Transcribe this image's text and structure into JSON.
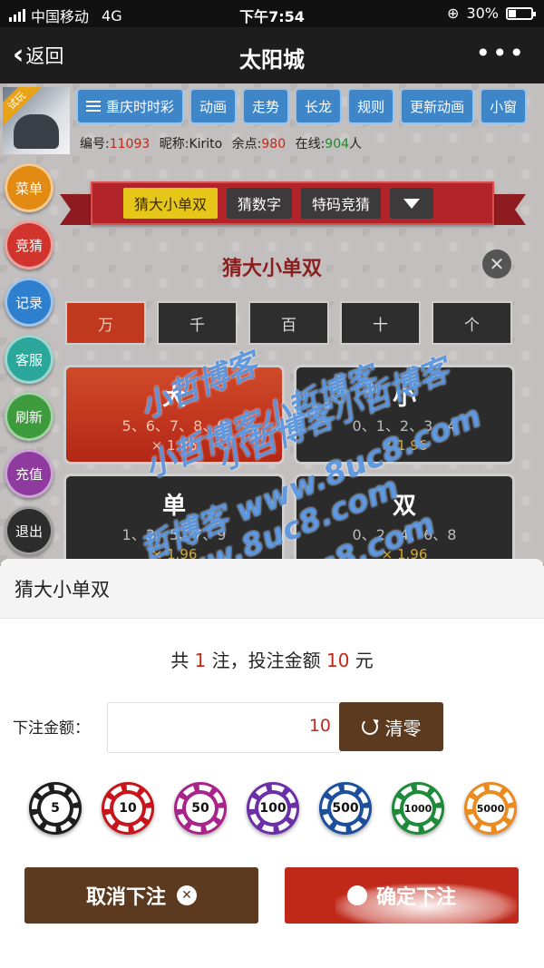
{
  "status_bar": {
    "carrier": "中国移动",
    "network": "4G",
    "time": "下午7:54",
    "battery": "30%"
  },
  "nav": {
    "back_label": "返回",
    "title": "太阳城",
    "more_label": "•••"
  },
  "avatar": {
    "badge": "试玩"
  },
  "top_tabs": [
    "重庆时时彩",
    "动画",
    "走势",
    "长龙",
    "规则",
    "更新动画",
    "小窗"
  ],
  "user_info": {
    "id_label": "编号:",
    "id": "11093",
    "nick_label": "昵称:",
    "nick": "Kirito",
    "balance_label": "余点:",
    "balance": "980",
    "online_label": "在线:",
    "online": "904",
    "online_unit": "人"
  },
  "sidebar": [
    {
      "label": "菜单",
      "color": "#e28a12"
    },
    {
      "label": "竞猜",
      "color": "#d0342c"
    },
    {
      "label": "记录",
      "color": "#2f7fcf"
    },
    {
      "label": "客服",
      "color": "#2aa79a"
    },
    {
      "label": "刷新",
      "color": "#3d9a3d"
    },
    {
      "label": "充值",
      "color": "#8e3a9e"
    },
    {
      "label": "退出",
      "color": "#2c2c2c"
    }
  ],
  "ribbon_tabs": [
    "猜大小单双",
    "猜数字",
    "特码竞猜"
  ],
  "game_title": "猜大小单双",
  "close_label": "✕",
  "digits": [
    "万",
    "千",
    "百",
    "十",
    "个"
  ],
  "bets": [
    {
      "label": "大",
      "nums": "5、6、7、8、9",
      "odds": "× 1.96",
      "active": true
    },
    {
      "label": "小",
      "nums": "0、1、2、3、4",
      "odds": "× 1.96",
      "active": false
    },
    {
      "label": "单",
      "nums": "1、3、5、7、9",
      "odds": "× 1.96",
      "active": false
    },
    {
      "label": "双",
      "nums": "0、2、4、6、8",
      "odds": "× 1.96",
      "active": false
    }
  ],
  "watermarks": [
    "小哲博客",
    "小哲博客小哲博客",
    "小哲博客小哲博客",
    "哲博客 www.8uc8.com",
    "www.8uc8.com",
    "www.8uc8.com"
  ],
  "sheet": {
    "title": "猜大小单双",
    "summary_prefix": "共 ",
    "count": "1",
    "summary_mid": " 注，投注金额 ",
    "amount": "10",
    "summary_suffix": " 元",
    "amount_label": "下注金额：",
    "amount_value": "10",
    "clear_label": "清零",
    "chips": [
      {
        "value": "5",
        "color": "#1e1e1e"
      },
      {
        "value": "10",
        "color": "#c8141b"
      },
      {
        "value": "50",
        "color": "#a8238a"
      },
      {
        "value": "100",
        "color": "#6b2fa8"
      },
      {
        "value": "500",
        "color": "#1d4f9c"
      },
      {
        "value": "1000",
        "color": "#1f8a3a"
      },
      {
        "value": "5000",
        "color": "#ea8a1f"
      }
    ],
    "cancel_label": "取消下注",
    "confirm_label": "确定下注"
  }
}
